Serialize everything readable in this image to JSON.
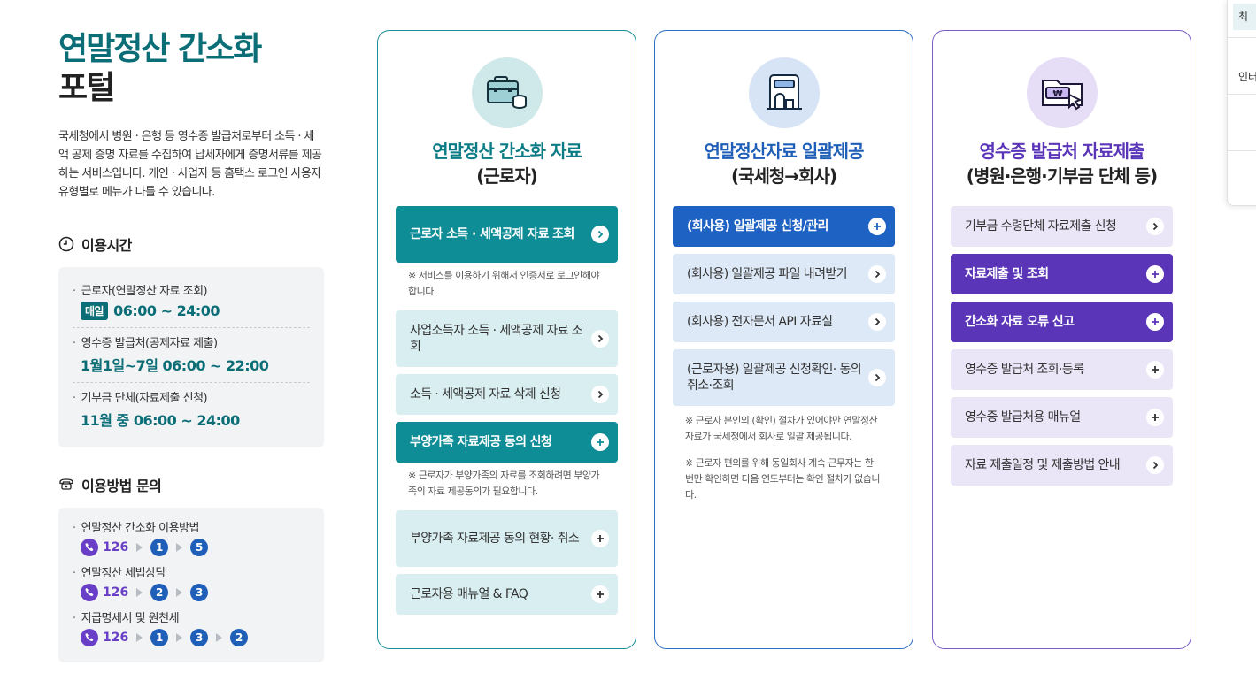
{
  "left": {
    "title_line1": "연말정산 간소화",
    "title_line2": "포털",
    "description": "국세청에서 병원 · 은행 등 영수증 발급처로부터 소득 · 세액 공제 증명 자료를 수집하여 납세자에게 증명서류를 제공하는 서비스입니다. 개인 · 사업자 등 홈택스 로그인 사용자 유형별로 메뉴가 다를 수 있습니다.",
    "hours_heading": "이용시간",
    "hours": [
      {
        "label": "근로자(연말정산 자료 조회)",
        "badge": "매일",
        "value": "06:00 ~ 24:00"
      },
      {
        "label": "영수증 발급처(공제자료 제출)",
        "badge": "",
        "value": "1월1일~7일 06:00 ~ 22:00"
      },
      {
        "label": "기부금 단체(자료제출 신청)",
        "badge": "",
        "value": "11월 중 06:00 ~ 24:00"
      }
    ],
    "inquiry_heading": "이용방법 문의",
    "inquiries": [
      {
        "label": "연말정산 간소화 이용방법",
        "phone": "126",
        "steps": [
          "1",
          "5"
        ]
      },
      {
        "label": "연말정산 세법상담",
        "phone": "126",
        "steps": [
          "2",
          "3"
        ]
      },
      {
        "label": "지급명세서 및 원천세",
        "phone": "126",
        "steps": [
          "1",
          "3",
          "2"
        ]
      }
    ]
  },
  "cards": [
    {
      "title": "연말정산 간소화 자료",
      "subtitle": "(근로자)",
      "title_color": "#0b7c85",
      "icon": "briefcase-coins-icon",
      "items": [
        {
          "label": "근로자 소득 · 세액공제 자료 조회",
          "style": "primary",
          "icon": "chevron-right-icon"
        },
        {
          "note": "※ 서비스를 이용하기 위해서 인증서로 로그인해야 합니다."
        },
        {
          "label": "사업소득자 소득 · 세액공제 자료 조회",
          "style": "secondary",
          "icon": "chevron-right-icon"
        },
        {
          "label": "소득 · 세액공제 자료 삭제 신청",
          "style": "secondary",
          "icon": "chevron-right-icon"
        },
        {
          "label": "부양가족 자료제공 동의 신청",
          "style": "primary",
          "icon": "plus-icon"
        },
        {
          "note": "※ 근로자가 부양가족의 자료를 조회하려면 부양가족의 자료 제공동의가 필요합니다."
        },
        {
          "label": "부양가족 자료제공 동의 현황· 취소",
          "style": "secondary",
          "icon": "plus-icon"
        },
        {
          "label": "근로자용 매뉴얼 & FAQ",
          "style": "secondary",
          "icon": "plus-icon"
        }
      ]
    },
    {
      "title": "연말정산자료 일괄제공",
      "subtitle": "(국세청→회사)",
      "title_color": "#1f5fb8",
      "icon": "building-icon",
      "items": [
        {
          "label": "(회사용) 일괄제공 신청/관리",
          "style": "primary",
          "icon": "plus-icon"
        },
        {
          "label": "(회사용) 일괄제공 파일 내려받기",
          "style": "secondary",
          "icon": "chevron-right-icon"
        },
        {
          "label": "(회사용) 전자문서 API 자료실",
          "style": "secondary",
          "icon": "chevron-right-icon"
        },
        {
          "label": "(근로자용) 일괄제공 신청확인· 동의취소·조회",
          "style": "secondary",
          "icon": "chevron-right-icon"
        },
        {
          "note": "※ 근로자 본인의 (확인) 절차가 있어야만 연말정산 자료가 국세청에서 회사로 일괄 제공됩니다."
        },
        {
          "note": "※ 근로자 편의를 위해 동일회사 계속 근무자는 한 번만 확인하면 다음 연도부터는 확인 절차가 없습니다."
        }
      ]
    },
    {
      "title": "영수증 발급처 자료제출",
      "subtitle": "(병원·은행·기부금 단체 등)",
      "title_color": "#5a35b8",
      "icon": "folder-won-icon",
      "items": [
        {
          "label": "기부금 수령단체 자료제출 신청",
          "style": "secondary",
          "icon": "chevron-right-icon"
        },
        {
          "label": "자료제출 및 조회",
          "style": "primary",
          "icon": "plus-icon"
        },
        {
          "label": "간소화 자료 오류 신고",
          "style": "primary",
          "icon": "plus-icon"
        },
        {
          "label": "영수증 발급처 조회·등록",
          "style": "secondary",
          "icon": "plus-icon"
        },
        {
          "label": "영수증 발급처용 매뉴얼",
          "style": "secondary",
          "icon": "plus-icon"
        },
        {
          "label": "자료 제출일정 및 제출방법 안내",
          "style": "secondary",
          "icon": "chevron-right-icon"
        }
      ]
    }
  ],
  "edge_panel": {
    "item1": "최",
    "item2": "인터"
  }
}
